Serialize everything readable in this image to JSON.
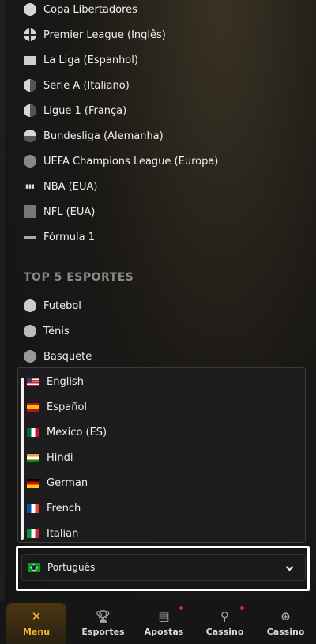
{
  "leagues": [
    {
      "label": "Copa Libertadores",
      "icon": "trophy-ball-icon"
    },
    {
      "label": "Premier League (Inglês)",
      "icon": "england-flag-icon"
    },
    {
      "label": "La Liga (Espanhol)",
      "icon": "laliga-icon"
    },
    {
      "label": "Serie A (Italiano)",
      "icon": "italy-flag-icon"
    },
    {
      "label": "Ligue 1 (França)",
      "icon": "france-flag-icon"
    },
    {
      "label": "Bundesliga (Alemanha)",
      "icon": "germany-flag-icon"
    },
    {
      "label": "UEFA Champions League (Europa)",
      "icon": "uefa-icon"
    },
    {
      "label": "NBA (EUA)",
      "icon": "nba-icon"
    },
    {
      "label": "NFL (EUA)",
      "icon": "nfl-icon"
    },
    {
      "label": "Fórmula 1",
      "icon": "f1-icon"
    }
  ],
  "top_sports": {
    "title": "TOP 5 ESPORTES",
    "items": [
      {
        "label": "Futebol",
        "icon": "soccer-ball-icon"
      },
      {
        "label": "Tênis",
        "icon": "tennis-ball-icon"
      },
      {
        "label": "Basquete",
        "icon": "basketball-icon"
      }
    ]
  },
  "language_dropdown": {
    "options": [
      {
        "label": "English",
        "flag": "us-flag-icon"
      },
      {
        "label": "Español",
        "flag": "spain-flag-icon"
      },
      {
        "label": "Mexico (ES)",
        "flag": "mexico-flag-icon"
      },
      {
        "label": "Hindi",
        "flag": "india-flag-icon"
      },
      {
        "label": "German",
        "flag": "germany-flag-icon"
      },
      {
        "label": "French",
        "flag": "france-flag-icon"
      },
      {
        "label": "Italian",
        "flag": "italy-flag-icon"
      }
    ],
    "selected": {
      "label": "Português",
      "flag": "brazil-flag-icon"
    }
  },
  "bottom_nav": [
    {
      "label": "Menu",
      "icon": "close-icon",
      "active": true
    },
    {
      "label": "Esportes",
      "icon": "trophy-icon"
    },
    {
      "label": "Apostas",
      "icon": "ticket-icon",
      "notification": true
    },
    {
      "label": "Cassino",
      "icon": "joystick-icon",
      "notification": true
    },
    {
      "label": "Cassino",
      "icon": "roulette-icon"
    }
  ],
  "colors": {
    "accent": "#f5b731",
    "notification": "#c2334a",
    "highlight_border": "#ffffff"
  }
}
